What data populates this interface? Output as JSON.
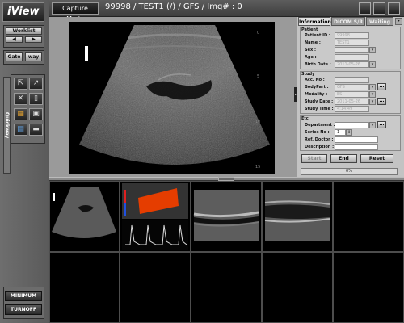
{
  "app": {
    "logo": "iView"
  },
  "left_panel": {
    "worklist": "Worklist",
    "nav_prev": "◀",
    "nav_next": "▶",
    "gate": "Gate",
    "way": "way",
    "quickway": "Quickway",
    "minimum": "MINIMUM",
    "turnoff": "TURNOFF",
    "tools": [
      "⇱",
      "↗",
      "✕",
      "▯",
      "▦",
      "▣",
      "▤",
      "▬"
    ]
  },
  "header": {
    "mode": "Capture Mode",
    "title": "99998  /  TEST1 (/)  /  GFS  /  Img# : 0"
  },
  "info": {
    "tabs": [
      "Information",
      "DICOM S/R",
      "Waiting"
    ],
    "patient": {
      "section": "Patient",
      "id_label": "Patient ID :",
      "id_value": "99998",
      "name_label": "Name :",
      "name_value": "TEST1",
      "sex_label": "Sex :",
      "sex_value": "",
      "age_label": "Age :",
      "age_value": "",
      "birth_label": "Birth Date :",
      "birth_value": "2011-05-26"
    },
    "study": {
      "section": "Study",
      "acc_label": "Acc. No :",
      "acc_value": "",
      "bodypart_label": "BodyPart :",
      "bodypart_value": "GFS",
      "modality_label": "Modality :",
      "modality_value": "ES",
      "date_label": "Study Date :",
      "date_value": "2011-05-26",
      "time_label": "Study Time :",
      "time_value": "4:14:49"
    },
    "etc": {
      "section": "Etc",
      "dept_label": "Department :",
      "dept_value": "",
      "series_label": "Series No :",
      "series_value": "1",
      "doctor_label": "Ref. Doctor :",
      "doctor_value": "",
      "desc_label": "Description :",
      "desc_value": ""
    },
    "buttons": {
      "start": "Start",
      "end": "End",
      "reset": "Reset"
    },
    "progress": "0%"
  },
  "image": {
    "depth_ticks": [
      "0",
      "5",
      "10",
      "15"
    ]
  },
  "thumbnail_grid": {
    "columns": 5,
    "rows": 2,
    "thumbnails": [
      "abdomen-ultrasound",
      "doppler-waveform",
      "vascular-scan-1",
      "vascular-scan-2"
    ]
  },
  "colors": {
    "panel": "#c3c3c3",
    "toolbar": "#4a4a4a",
    "doppler_red": "#e53d00"
  }
}
